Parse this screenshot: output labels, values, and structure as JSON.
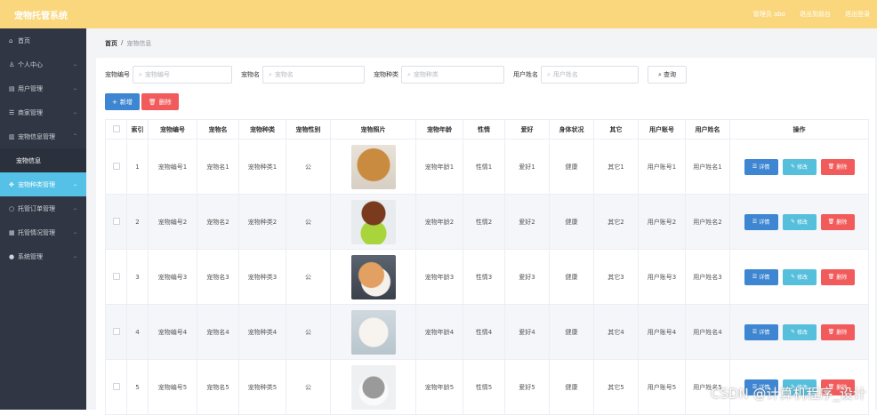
{
  "app": {
    "title": "宠物托管系统"
  },
  "header": {
    "links": [
      "管理员 abo",
      "退出到前台",
      "退出登录"
    ]
  },
  "sidebar": {
    "items": [
      {
        "icon": "home-icon",
        "glyph": "⌂",
        "label": "首页"
      },
      {
        "icon": "user-icon",
        "glyph": "♙",
        "label": "个人中心"
      },
      {
        "icon": "users-icon",
        "glyph": "▤",
        "label": "用户管理"
      },
      {
        "icon": "shop-icon",
        "glyph": "☰",
        "label": "商家管理"
      },
      {
        "icon": "chart-icon",
        "glyph": "▥",
        "label": "宠物信息管理"
      }
    ],
    "sub_item": "宠物信息",
    "items2": [
      {
        "icon": "pet-icon",
        "glyph": "✥",
        "label": "宠物种类管理"
      },
      {
        "icon": "order-icon",
        "glyph": "○",
        "label": "托管订单管理"
      },
      {
        "icon": "status-icon",
        "glyph": "▦",
        "label": "托管情况管理"
      },
      {
        "icon": "system-icon",
        "glyph": "●",
        "label": "系统管理"
      }
    ]
  },
  "breadcrumb": {
    "home": "首页",
    "sep": "/",
    "current": "宠物信息"
  },
  "filters": [
    {
      "label": "宠物编号",
      "placeholder": "宠物编号"
    },
    {
      "label": "宠物名",
      "placeholder": "宠物名"
    },
    {
      "label": "宠物种类",
      "placeholder": "宠物种类"
    },
    {
      "label": "用户姓名",
      "placeholder": "用户姓名"
    }
  ],
  "search_button": "查询",
  "actions": {
    "add": "新增",
    "delete": "删除"
  },
  "table": {
    "headers": [
      "",
      "索引",
      "宠物编号",
      "宠物名",
      "宠物种类",
      "宠物性别",
      "宠物照片",
      "宠物年龄",
      "性情",
      "爱好",
      "身体状况",
      "其它",
      "用户账号",
      "用户姓名",
      "操作"
    ],
    "rows": [
      {
        "index": "1",
        "code": "宠物编号1",
        "name": "宠物名1",
        "kind": "宠物种类1",
        "gender": "公",
        "photo": "dog-photo",
        "age": "宠物年龄1",
        "temper": "性情1",
        "hobby": "爱好1",
        "health": "健康",
        "other": "其它1",
        "account": "用户账号1",
        "username": "用户姓名1"
      },
      {
        "index": "2",
        "code": "宠物编号2",
        "name": "宠物名2",
        "kind": "宠物种类2",
        "gender": "公",
        "photo": "poodle-photo",
        "age": "宠物年龄2",
        "temper": "性情2",
        "hobby": "爱好2",
        "health": "健康",
        "other": "其它2",
        "account": "用户账号2",
        "username": "用户姓名2"
      },
      {
        "index": "3",
        "code": "宠物编号3",
        "name": "宠物名3",
        "kind": "宠物种类3",
        "gender": "公",
        "photo": "cat-photo",
        "age": "宠物年龄3",
        "temper": "性情3",
        "hobby": "爱好3",
        "health": "健康",
        "other": "其它3",
        "account": "用户账号3",
        "username": "用户姓名3"
      },
      {
        "index": "4",
        "code": "宠物编号4",
        "name": "宠物名4",
        "kind": "宠物种类4",
        "gender": "公",
        "photo": "white-cat-photo",
        "age": "宠物年龄4",
        "temper": "性情4",
        "hobby": "爱好4",
        "health": "健康",
        "other": "其它4",
        "account": "用户账号4",
        "username": "用户姓名4"
      },
      {
        "index": "5",
        "code": "宠物编号5",
        "name": "宠物名5",
        "kind": "宠物种类5",
        "gender": "公",
        "photo": "rat-photo",
        "age": "宠物年龄5",
        "temper": "性情5",
        "hobby": "爱好5",
        "health": "健康",
        "other": "其它5",
        "account": "用户账号5",
        "username": "用户姓名5"
      }
    ],
    "row_ops": {
      "detail": "详情",
      "edit": "修改",
      "delete": "删除"
    }
  },
  "watermark": "CSDN @计算机程序_设计"
}
